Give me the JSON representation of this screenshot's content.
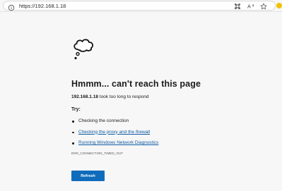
{
  "browser": {
    "url": "https://192.168.1.18"
  },
  "toolbar_icons": [
    "info-icon",
    "extensions-icon",
    "read-aloud-icon",
    "favorite-star-icon",
    "profile-icon"
  ],
  "error_page": {
    "icon": "thinking-cloud-icon",
    "heading": "Hmmm... can't reach this page",
    "host": "192.168.1.18",
    "subtitle_rest": " took too long to respond",
    "try_label": "Try:",
    "suggestions": [
      {
        "text": "Checking the connection",
        "link": false
      },
      {
        "text": "Checking the proxy and the firewall",
        "link": true
      },
      {
        "text": "Running Windows Network Diagnostics",
        "link": true
      }
    ],
    "error_code": "ERR_CONNECTION_TIMED_OUT",
    "refresh_label": "Refresh"
  },
  "colors": {
    "background": "#f7f7f7",
    "link": "#0f5ba3",
    "button": "#0f6cbd",
    "profile": "#f2c200"
  }
}
